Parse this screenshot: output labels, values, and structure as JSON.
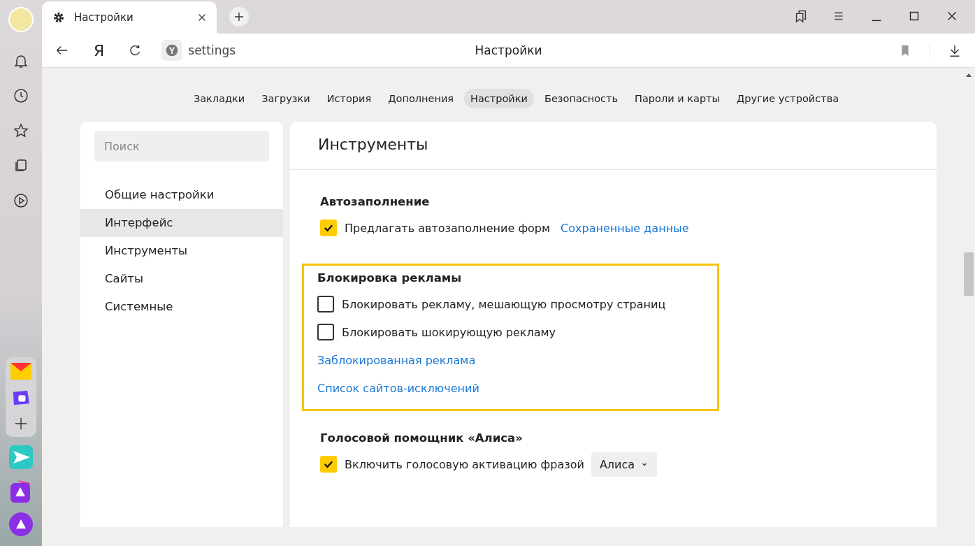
{
  "browser_tab": {
    "title": "Настройки"
  },
  "address_bar": {
    "logo_letter": "Я",
    "url": "settings",
    "page_title": "Настройки"
  },
  "nav_tabs": [
    {
      "label": "Закладки",
      "selected": false
    },
    {
      "label": "Загрузки",
      "selected": false
    },
    {
      "label": "История",
      "selected": false
    },
    {
      "label": "Дополнения",
      "selected": false
    },
    {
      "label": "Настройки",
      "selected": true
    },
    {
      "label": "Безопасность",
      "selected": false
    },
    {
      "label": "Пароли и карты",
      "selected": false
    },
    {
      "label": "Другие устройства",
      "selected": false
    }
  ],
  "sidebar": {
    "search": {
      "placeholder": "Поиск"
    },
    "items": [
      {
        "label": "Общие настройки",
        "selected": false
      },
      {
        "label": "Интерфейс",
        "selected": true
      },
      {
        "label": "Инструменты",
        "selected": false
      },
      {
        "label": "Сайты",
        "selected": false
      },
      {
        "label": "Системные",
        "selected": false
      }
    ]
  },
  "panel": {
    "title": "Инструменты",
    "sections": [
      {
        "title": "Автозаполнение",
        "highlighted": false,
        "rows": [
          {
            "kind": "checkbox",
            "label": "Предлагать автозаполнение форм",
            "checked": true,
            "link": "Сохраненные данные"
          }
        ]
      },
      {
        "title": "Блокировка рекламы",
        "highlighted": true,
        "rows": [
          {
            "kind": "checkbox",
            "label": "Блокировать рекламу, мешающую просмотру страниц",
            "checked": false
          },
          {
            "kind": "checkbox",
            "label": "Блокировать шокирующую рекламу",
            "checked": false
          },
          {
            "kind": "link",
            "label": "Заблокированная реклама"
          },
          {
            "kind": "link",
            "label": "Список сайтов-исключений"
          }
        ]
      },
      {
        "title": "Голосовой помощник «Алиса»",
        "highlighted": false,
        "rows": [
          {
            "kind": "checkbox",
            "label": "Включить голосовую активацию фразой",
            "checked": true,
            "select": "Алиса"
          }
        ]
      }
    ]
  }
}
